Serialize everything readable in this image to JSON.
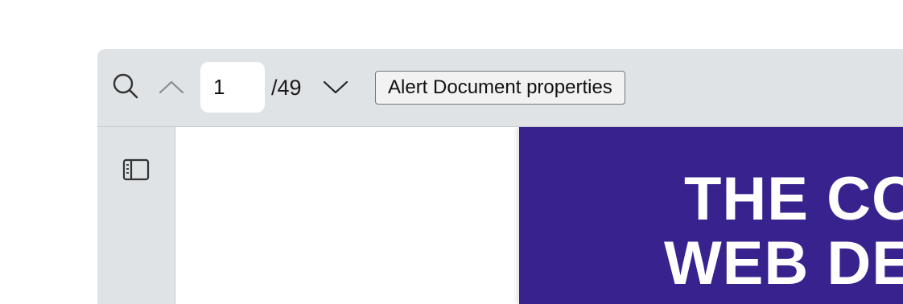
{
  "toolbar": {
    "search_icon": "search-icon",
    "prev_icon": "chevron-up-icon",
    "page_input_value": "1",
    "page_total": "/49",
    "next_icon": "chevron-down-icon",
    "properties_button_label": "Alert Document properties"
  },
  "sidebar": {
    "toggle_icon": "sidebar-toggle-icon"
  },
  "document": {
    "cover_title_line_1": "THE CO",
    "cover_title_line_2": "WEB DE",
    "cover_color": "#37228e"
  },
  "colors": {
    "chrome_background": "#dfe3e6",
    "page_background": "#ffffff"
  }
}
